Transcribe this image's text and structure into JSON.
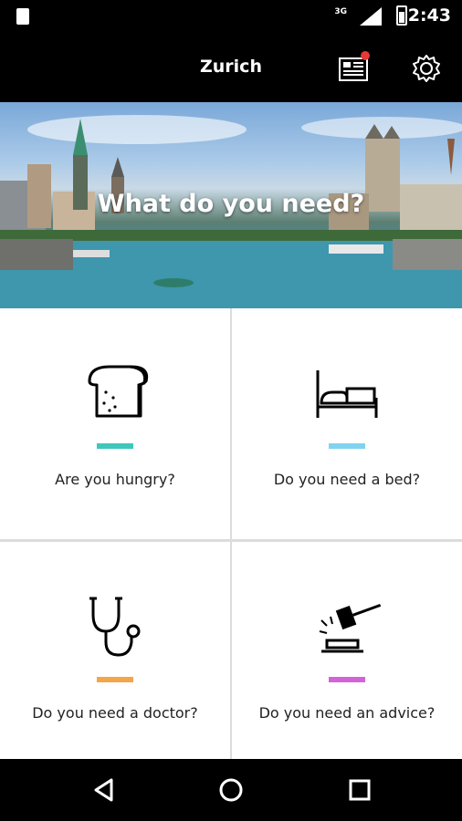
{
  "status_bar": {
    "network": "3G",
    "time": "2:43"
  },
  "app_bar": {
    "title": "Zurich"
  },
  "hero": {
    "title": "What do you need?"
  },
  "tiles": [
    {
      "label": "Are you hungry?",
      "icon": "bread-icon",
      "accent": "#3fc7bd"
    },
    {
      "label": "Do you need a bed?",
      "icon": "bed-icon",
      "accent": "#7fd3ee"
    },
    {
      "label": "Do you need a doctor?",
      "icon": "stethoscope-icon",
      "accent": "#f4a54a"
    },
    {
      "label": "Do you need an advice?",
      "icon": "gavel-icon",
      "accent": "#d264d8"
    }
  ],
  "nav": {
    "back": "back-icon",
    "home": "home-icon",
    "recents": "recents-icon"
  }
}
